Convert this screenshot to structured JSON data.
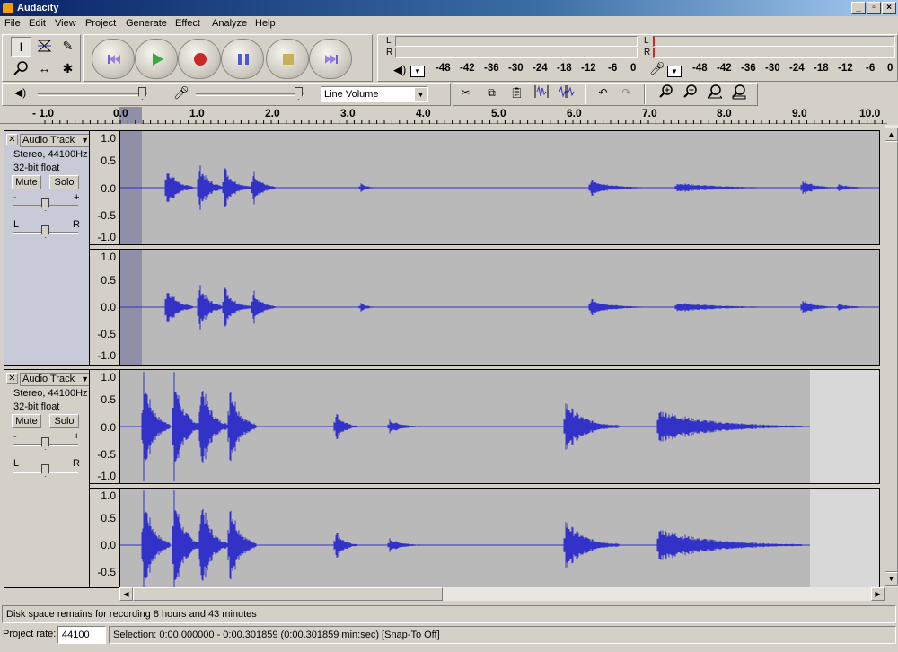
{
  "window": {
    "title": "Audacity",
    "minimize": "_",
    "maximize": "▫",
    "close": "×"
  },
  "menu": [
    "File",
    "Edit",
    "View",
    "Project",
    "Generate",
    "Effect",
    "Analyze",
    "Help"
  ],
  "tools": {
    "selection": "selection-tool-icon",
    "envelope": "envelope-tool-icon",
    "draw": "draw-tool-icon",
    "zoom": "zoom-tool-icon",
    "timeshift": "timeshift-tool-icon",
    "multi": "multi-tool-icon"
  },
  "meters": {
    "output": {
      "L": "L",
      "R": "R",
      "scale": [
        "-48",
        "-42",
        "-36",
        "-30",
        "-24",
        "-18",
        "-12",
        "-6",
        "0"
      ]
    },
    "input": {
      "L": "L",
      "R": "R",
      "scale": [
        "-48",
        "-42",
        "-36",
        "-30",
        "-24",
        "-18",
        "-12",
        "-6",
        "0"
      ]
    }
  },
  "mixer": {
    "input_source": "Line Volume"
  },
  "ruler": [
    "- 1.0",
    "0.0",
    "1.0",
    "2.0",
    "3.0",
    "4.0",
    "5.0",
    "6.0",
    "7.0",
    "8.0",
    "9.0",
    "10.0"
  ],
  "tracks": [
    {
      "name": "Audio Track",
      "info_line1": "Stereo, 44100Hz",
      "info_line2": "32-bit float",
      "mute": "Mute",
      "solo": "Solo",
      "gain_minus": "-",
      "gain_plus": "+",
      "pan_left": "L",
      "pan_right": "R",
      "scale_ch1": [
        "1.0",
        "0.5",
        "0.0",
        "-0.5",
        "-1.0"
      ],
      "scale_ch2": [
        "1.0",
        "0.5",
        "0.0",
        "-0.5",
        "-1.0"
      ]
    },
    {
      "name": "Audio Track",
      "info_line1": "Stereo, 44100Hz",
      "info_line2": "32-bit float",
      "mute": "Mute",
      "solo": "Solo",
      "gain_minus": "-",
      "gain_plus": "+",
      "pan_left": "L",
      "pan_right": "R",
      "scale_ch1": [
        "1.0",
        "0.5",
        "0.0",
        "-0.5",
        "-1.0"
      ],
      "scale_ch2": [
        "1.0",
        "0.5",
        "0.0",
        "-0.5"
      ]
    }
  ],
  "status": {
    "disk_space": "Disk space remains for recording 8 hours and 43 minutes",
    "project_rate_label": "Project rate:",
    "project_rate": "44100",
    "selection": "Selection: 0:00.000000 - 0:00.301859 (0:00.301859 min:sec)   [Snap-To Off]"
  },
  "colors": {
    "waveform": "#3232c8",
    "track_bg": "#b9b9b9",
    "selection": "#8f8fa8",
    "chrome": "#d4d0c8"
  }
}
